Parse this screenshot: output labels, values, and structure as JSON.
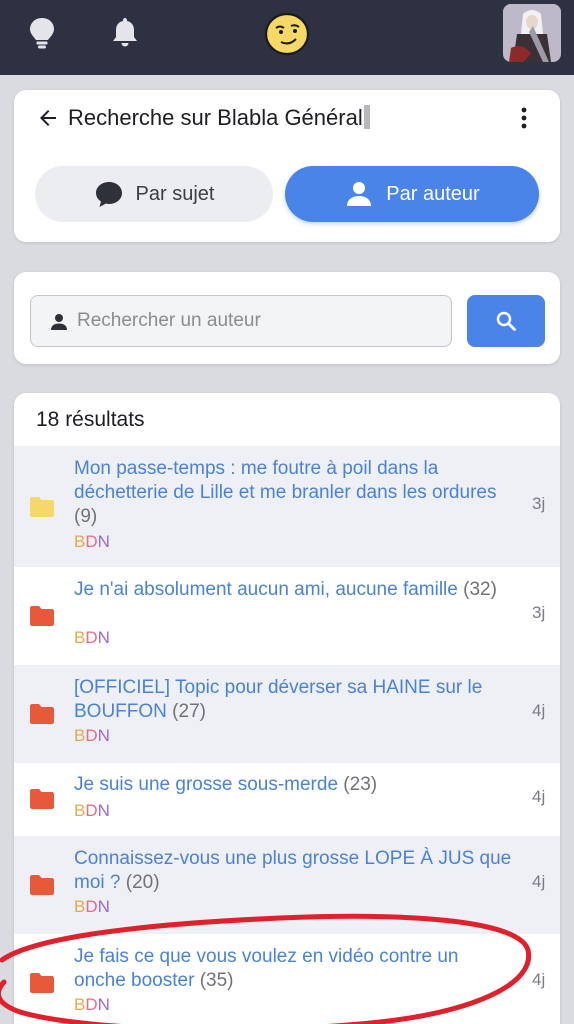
{
  "topbar": {
    "icons": [
      "lightbulb-icon",
      "bell-icon",
      "smiley-logo-icon"
    ],
    "avatar": "user-avatar"
  },
  "header": {
    "title": "Recherche sur Blabla Général",
    "back_icon": "arrow-left-icon",
    "menu_icon": "kebab-menu-icon"
  },
  "tabs": [
    {
      "label": "Par sujet",
      "icon": "chat-bubble-icon",
      "active": false
    },
    {
      "label": "Par auteur",
      "icon": "person-icon",
      "active": true
    }
  ],
  "search": {
    "placeholder": "Rechercher un auteur",
    "value": "",
    "button_icon": "search-icon"
  },
  "results": {
    "count_label": "18 résultats",
    "items": [
      {
        "title": "Mon passe-temps : me foutre à poil dans la déchetterie de Lille et me branler dans les ordures",
        "count": "(9)",
        "author": "BDN",
        "age": "3j",
        "folder_color": "#f5d868"
      },
      {
        "title": "Je n'ai absolument aucun ami, aucune famille",
        "count": "(32)",
        "author": "BDN",
        "age": "3j",
        "folder_color": "#e8583a"
      },
      {
        "title": "[OFFICIEL] Topic pour déverser sa HAINE sur le BOUFFON",
        "count": "(27)",
        "author": "BDN",
        "age": "4j",
        "folder_color": "#e8583a"
      },
      {
        "title": "Je suis une grosse sous-merde",
        "count": "(23)",
        "author": "BDN",
        "age": "4j",
        "folder_color": "#e8583a"
      },
      {
        "title": "Connaissez-vous une plus grosse LOPE À JUS que moi ?",
        "count": "(20)",
        "author": "BDN",
        "age": "4j",
        "folder_color": "#e8583a"
      },
      {
        "title": "Je fais ce que vous voulez en vidéo contre un onche booster",
        "count": "(35)",
        "author": "BDN",
        "age": "4j",
        "folder_color": "#e8583a"
      }
    ]
  },
  "colors": {
    "accent": "#4b84e8",
    "topbar": "#2d3142",
    "link": "#4a82d6",
    "annotation": "#e0202a"
  }
}
